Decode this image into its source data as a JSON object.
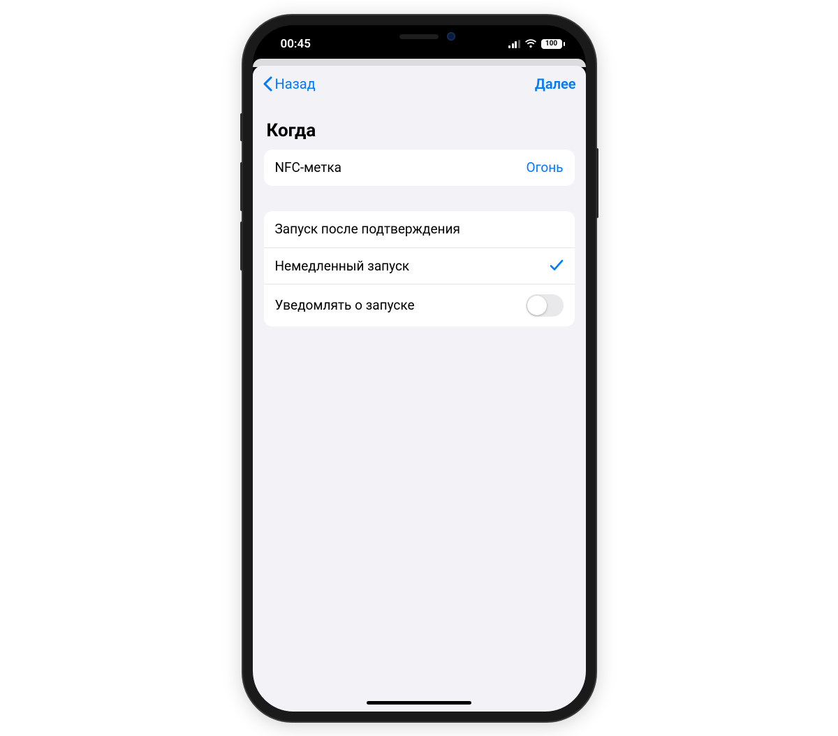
{
  "status": {
    "time": "00:45",
    "battery": "100"
  },
  "nav": {
    "back_label": "Назад",
    "next_label": "Далее"
  },
  "section_title": "Когда",
  "trigger": {
    "label": "NFC-метка",
    "value": "Огонь"
  },
  "options": {
    "confirm_label": "Запуск после подтверждения",
    "immediate_label": "Немедленный запуск",
    "notify_label": "Уведомлять о запуске",
    "immediate_selected": true,
    "notify_on": false
  }
}
